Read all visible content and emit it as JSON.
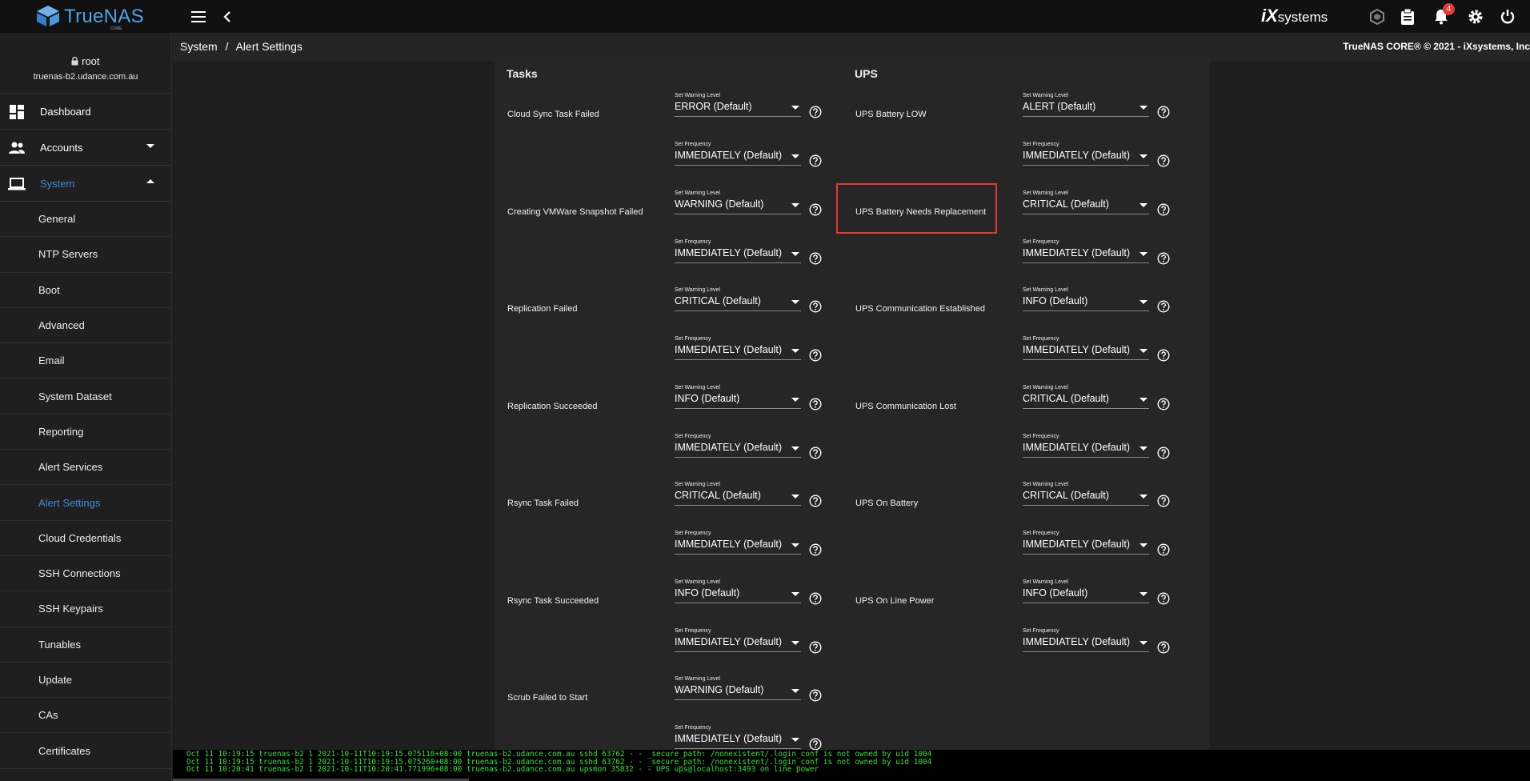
{
  "topbar": {
    "logo_text": "TrueNAS",
    "logo_sub": "CORE",
    "vendor_brand": "iX",
    "vendor_suffix": "systems",
    "notification_count": "4"
  },
  "user": {
    "name": "root",
    "host": "truenas-b2.udance.com.au"
  },
  "sidebar": {
    "main_items": [
      {
        "label": "Dashboard"
      },
      {
        "label": "Accounts"
      },
      {
        "label": "System"
      }
    ],
    "system_items": [
      {
        "label": "General"
      },
      {
        "label": "NTP Servers"
      },
      {
        "label": "Boot"
      },
      {
        "label": "Advanced"
      },
      {
        "label": "Email"
      },
      {
        "label": "System Dataset"
      },
      {
        "label": "Reporting"
      },
      {
        "label": "Alert Services"
      },
      {
        "label": "Alert Settings"
      },
      {
        "label": "Cloud Credentials"
      },
      {
        "label": "SSH Connections"
      },
      {
        "label": "SSH Keypairs"
      },
      {
        "label": "Tunables"
      },
      {
        "label": "Update"
      },
      {
        "label": "CAs"
      },
      {
        "label": "Certificates"
      }
    ]
  },
  "breadcrumb": {
    "parent": "System",
    "separator": "/",
    "current": "Alert Settings"
  },
  "copyright": "TrueNAS CORE® © 2021 - iXsystems, Inc",
  "captions": {
    "level": "Set Warning Level",
    "frequency": "Set Frequency"
  },
  "sections": [
    {
      "title": "Tasks",
      "alerts": [
        {
          "name": "Cloud Sync Task Failed",
          "level": "ERROR (Default)",
          "frequency": "IMMEDIATELY (Default)"
        },
        {
          "name": "Creating VMWare Snapshot Failed",
          "level": "WARNING (Default)",
          "frequency": "IMMEDIATELY (Default)"
        },
        {
          "name": "Replication Failed",
          "level": "CRITICAL (Default)",
          "frequency": "IMMEDIATELY (Default)"
        },
        {
          "name": "Replication Succeeded",
          "level": "INFO (Default)",
          "frequency": "IMMEDIATELY (Default)"
        },
        {
          "name": "Rsync Task Failed",
          "level": "CRITICAL (Default)",
          "frequency": "IMMEDIATELY (Default)"
        },
        {
          "name": "Rsync Task Succeeded",
          "level": "INFO (Default)",
          "frequency": "IMMEDIATELY (Default)"
        },
        {
          "name": "Scrub Failed to Start",
          "level": "WARNING (Default)",
          "frequency": "IMMEDIATELY (Default)"
        }
      ]
    },
    {
      "title": "UPS",
      "alerts": [
        {
          "name": "UPS Battery LOW",
          "level": "ALERT (Default)",
          "frequency": "IMMEDIATELY (Default)"
        },
        {
          "name": "UPS Battery Needs Replacement",
          "level": "CRITICAL (Default)",
          "frequency": "IMMEDIATELY (Default)"
        },
        {
          "name": "UPS Communication Established",
          "level": "INFO (Default)",
          "frequency": "IMMEDIATELY (Default)"
        },
        {
          "name": "UPS Communication Lost",
          "level": "CRITICAL (Default)",
          "frequency": "IMMEDIATELY (Default)"
        },
        {
          "name": "UPS On Battery",
          "level": "CRITICAL (Default)",
          "frequency": "IMMEDIATELY (Default)"
        },
        {
          "name": "UPS On Line Power",
          "level": "INFO (Default)",
          "frequency": "IMMEDIATELY (Default)"
        }
      ]
    }
  ],
  "console_lines": [
    "Oct 11 10:19:15 truenas-b2 1 2021-10-11T10:19:15.075118+08:00 truenas-b2.udance.com.au sshd 63762 - - _secure_path: /nonexistent/.login_conf is not owned by uid 1004",
    "Oct 11 10:19:15 truenas-b2 1 2021-10-11T10:19:15.075260+08:00 truenas-b2.udance.com.au sshd 63762 - - _secure_path: /nonexistent/.login_conf is not owned by uid 1004",
    "Oct 11 10:20:41 truenas-b2 1 2021-10-11T10:20:41.771996+08:00 truenas-b2.udance.com.au upsmon 35832 - - UPS ups@localhost:3493 on line power"
  ],
  "colors": {
    "accent": "#3f8ad8",
    "highlight": "#e53935",
    "console_text": "#2ee82e"
  },
  "icons": [
    "menu-icon",
    "back-chevron-icon",
    "truecommand-icon",
    "clipboard-icon",
    "bell-icon",
    "gear-icon",
    "power-icon",
    "lock-icon",
    "dashboard-icon",
    "accounts-icon",
    "laptop-icon",
    "help-icon"
  ]
}
